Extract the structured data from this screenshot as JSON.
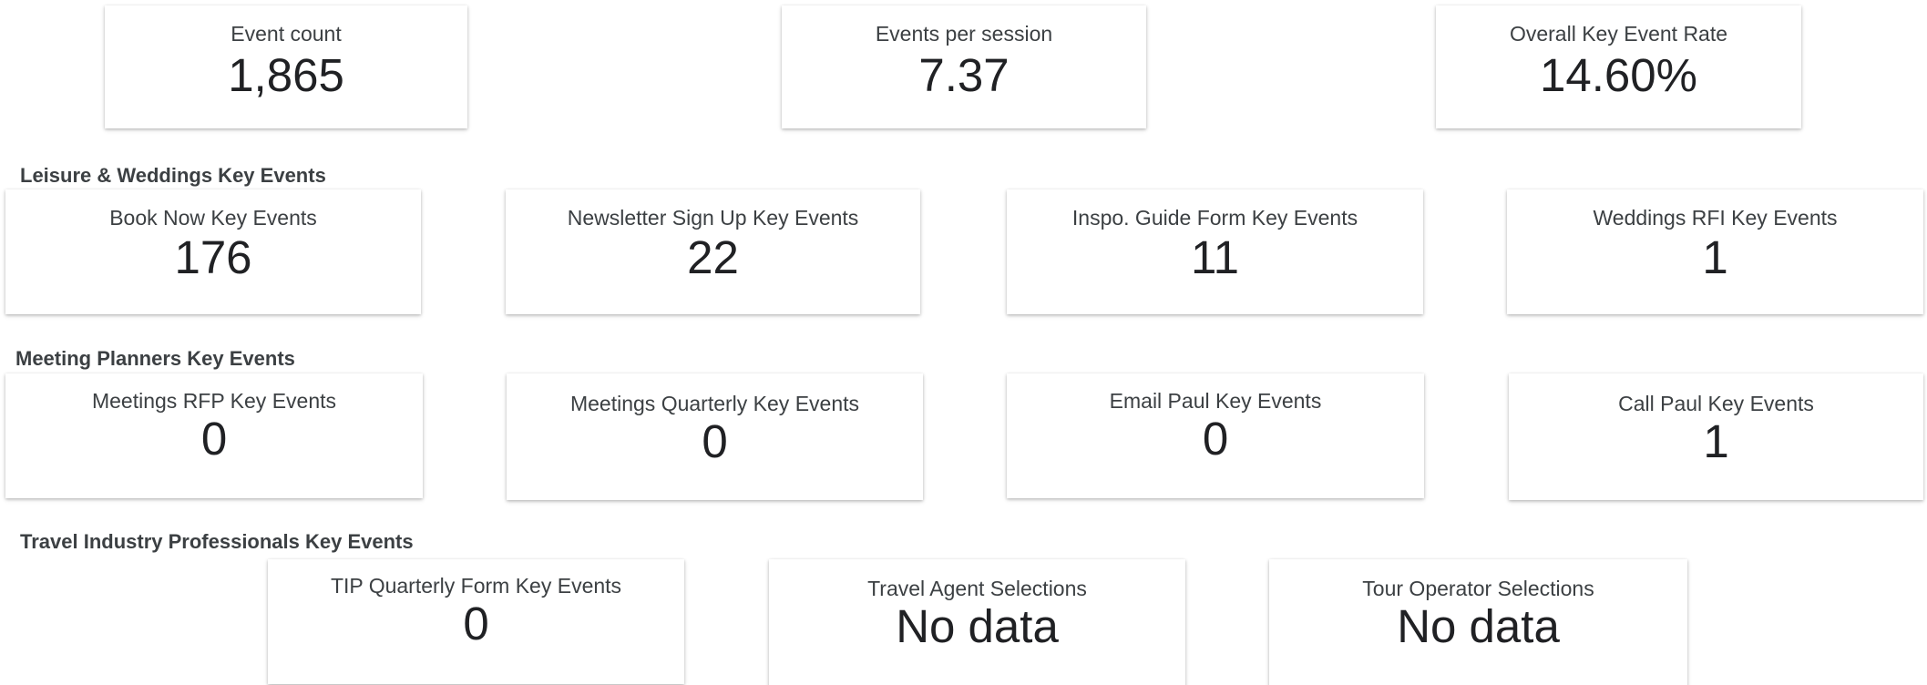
{
  "overview": {
    "event_count": {
      "label": "Event count",
      "value": "1,865"
    },
    "events_per_session": {
      "label": "Events per session",
      "value": "7.37"
    },
    "key_event_rate": {
      "label": "Overall Key Event Rate",
      "value": "14.60%"
    }
  },
  "leisure": {
    "title": "Leisure & Weddings Key Events",
    "cards": [
      {
        "label": "Book Now Key Events",
        "value": "176"
      },
      {
        "label": "Newsletter Sign Up Key Events",
        "value": "22"
      },
      {
        "label": "Inspo. Guide Form Key Events",
        "value": "11"
      },
      {
        "label": "Weddings RFI Key Events",
        "value": "1"
      }
    ]
  },
  "meetings": {
    "title": "Meeting Planners Key Events",
    "cards": [
      {
        "label": "Meetings RFP Key Events",
        "value": "0"
      },
      {
        "label": "Meetings Quarterly Key Events",
        "value": "0"
      },
      {
        "label": "Email Paul Key Events",
        "value": "0"
      },
      {
        "label": "Call Paul Key Events",
        "value": "1"
      }
    ]
  },
  "travel": {
    "title": "Travel Industry Professionals Key Events",
    "cards": [
      {
        "label": "TIP Quarterly Form Key Events",
        "value": "0"
      },
      {
        "label": "Travel Agent Selections",
        "value": "No data"
      },
      {
        "label": "Tour Operator Selections",
        "value": "No data"
      }
    ]
  }
}
